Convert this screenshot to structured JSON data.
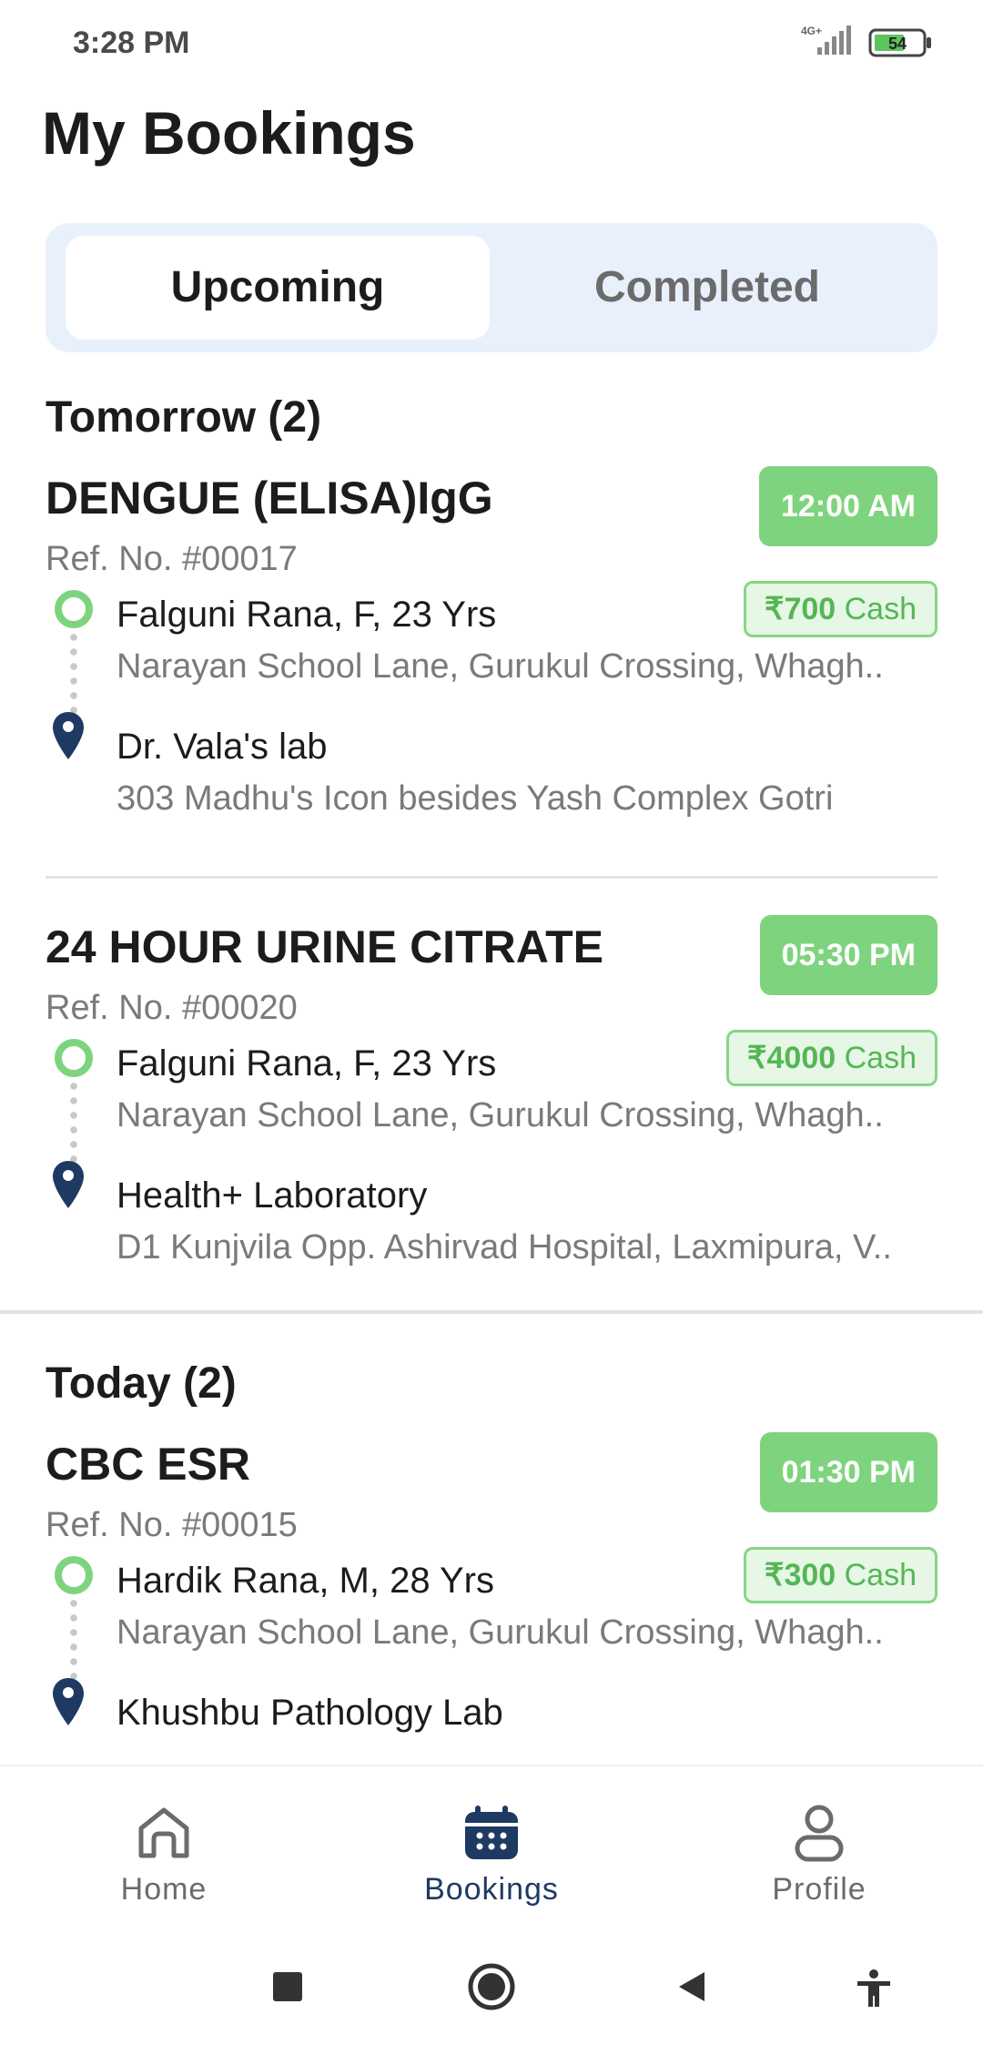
{
  "status_bar": {
    "time": "3:28 PM",
    "network": "4G+",
    "battery": "54"
  },
  "page_title": "My Bookings",
  "tabs": {
    "upcoming": "Upcoming",
    "completed": "Completed",
    "active": "upcoming"
  },
  "sections": [
    {
      "title": "Tomorrow (2)",
      "bookings": [
        {
          "test_name": "DENGUE (ELISA)IgG",
          "ref_no": "Ref. No. #00017",
          "time": "12:00 AM",
          "price": "₹700",
          "payment_mode": "Cash",
          "patient": "Falguni Rana, F, 23 Yrs",
          "patient_address": "Narayan School Lane, Gurukul Crossing, Whagh..",
          "lab_name": "Dr. Vala's lab",
          "lab_address": "303 Madhu's Icon besides Yash Complex Gotri"
        },
        {
          "test_name": "24 HOUR URINE CITRATE",
          "ref_no": "Ref. No. #00020",
          "time": "05:30 PM",
          "price": "₹4000",
          "payment_mode": "Cash",
          "patient": "Falguni Rana, F, 23 Yrs",
          "patient_address": "Narayan School Lane, Gurukul Crossing, Whagh..",
          "lab_name": "Health+ Laboratory",
          "lab_address": "D1 Kunjvila Opp. Ashirvad Hospital, Laxmipura, V.."
        }
      ]
    },
    {
      "title": "Today (2)",
      "bookings": [
        {
          "test_name": "CBC ESR",
          "ref_no": "Ref. No. #00015",
          "time": "01:30 PM",
          "price": "₹300",
          "payment_mode": "Cash",
          "patient": "Hardik Rana, M, 28 Yrs",
          "patient_address": "Narayan School Lane, Gurukul Crossing, Whagh..",
          "lab_name": "Khushbu Pathology Lab",
          "lab_address": ""
        }
      ]
    }
  ],
  "bottom_nav": {
    "home": "Home",
    "bookings": "Bookings",
    "profile": "Profile",
    "active": "bookings"
  },
  "colors": {
    "accent_green": "#7ed47e",
    "nav_active": "#1e3a63",
    "tab_bg": "#e8f0fb"
  }
}
